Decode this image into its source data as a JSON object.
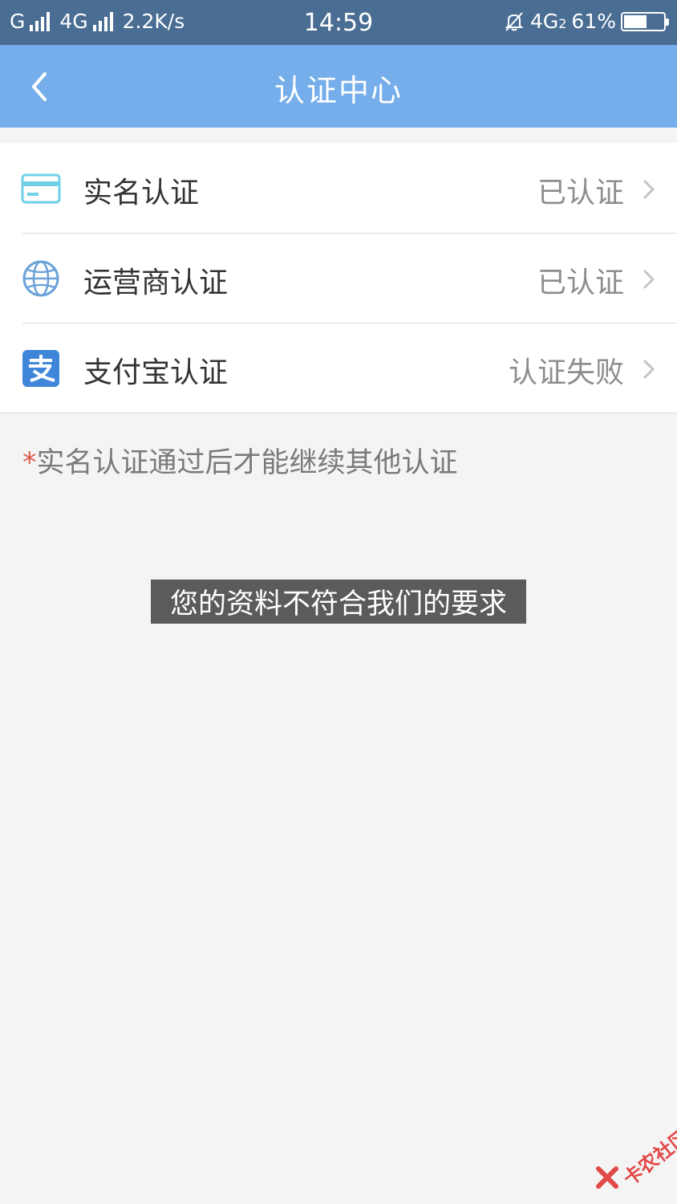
{
  "status_bar": {
    "carrier1": "G",
    "carrier2": "4G",
    "speed": "2.2K/s",
    "time": "14:59",
    "network": "4G",
    "network_sub": "2",
    "battery": "61%",
    "battery_level": 0.61
  },
  "nav": {
    "title": "认证中心",
    "back_icon": "chevron-left-icon"
  },
  "items": [
    {
      "label": "实名认证",
      "status": "已认证",
      "icon": "id-card-icon",
      "icon_color": "#6fd0e6"
    },
    {
      "label": "运营商认证",
      "status": "已认证",
      "icon": "globe-icon",
      "icon_color": "#6aa2d9"
    },
    {
      "label": "支付宝认证",
      "status": "认证失败",
      "icon": "alipay-icon",
      "icon_color": "#3f86d9"
    }
  ],
  "note": {
    "star": "*",
    "text": "实名认证通过后才能继续其他认证"
  },
  "toast": {
    "text": "您的资料不符合我们的要求"
  },
  "watermark": {
    "text": "卡农社区"
  },
  "colors": {
    "status_bar_bg": "#4a6d94",
    "nav_bg": "#75aeea",
    "page_bg": "#f4f4f4",
    "star": "#e0574a"
  }
}
